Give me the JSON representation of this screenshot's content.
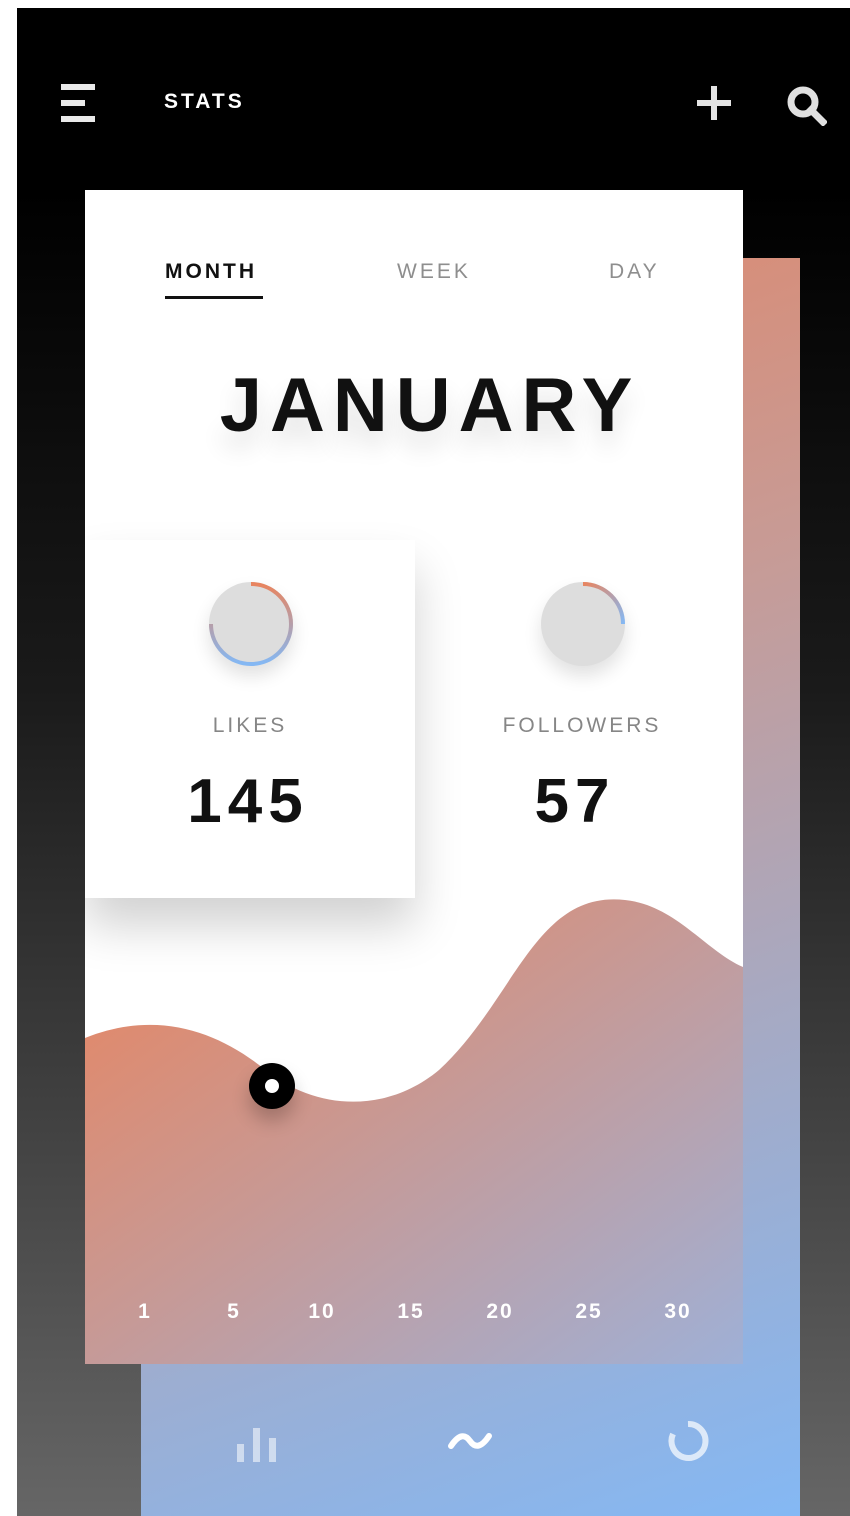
{
  "header": {
    "title": "STATS"
  },
  "tabs": {
    "items": [
      {
        "label": "MONTH",
        "active": true
      },
      {
        "label": "WEEK",
        "active": false
      },
      {
        "label": "DAY",
        "active": false
      }
    ]
  },
  "period": {
    "title": "JANUARY"
  },
  "stats": {
    "likes": {
      "label": "LIKES",
      "value": "145"
    },
    "followers": {
      "label": "FOLLOWERS",
      "value": "57"
    }
  },
  "chart": {
    "x_labels": [
      "1",
      "5",
      "10",
      "15",
      "20",
      "25",
      "30"
    ]
  },
  "colors": {
    "accent_orange": "#e18668",
    "accent_blue": "#84b8f4"
  },
  "icons": {
    "menu": "menu-icon",
    "add": "plus-icon",
    "search": "search-icon",
    "bar_chart": "bar-chart-icon",
    "wave": "wave-icon",
    "circle": "circle-icon"
  }
}
